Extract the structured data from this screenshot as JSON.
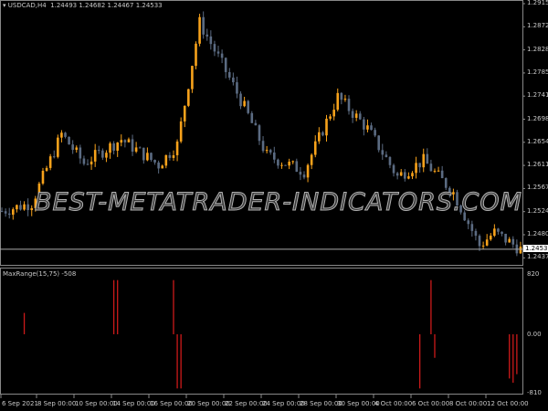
{
  "header": {
    "symbol": "USDCAD,H4",
    "quote": "1.24493 1.24682 1.24467 1.24533"
  },
  "price_axis": {
    "ticks": [
      "1.29155",
      "1.28720",
      "1.28285",
      "1.27850",
      "1.27415",
      "1.26980",
      "1.26545",
      "1.26110",
      "1.25675",
      "1.25240",
      "1.24805",
      "1.24370"
    ],
    "current": "1.24533"
  },
  "indicator": {
    "label": "MaxRange(15,75) -508",
    "ticks": [
      "820",
      "0.00",
      "-810"
    ]
  },
  "time_axis": [
    "6 Sep 2021",
    "8 Sep 00:00",
    "10 Sep 00:00",
    "14 Sep 00:00",
    "16 Sep 00:00",
    "20 Sep 00:00",
    "22 Sep 00:00",
    "24 Sep 00:00",
    "28 Sep 00:00",
    "30 Sep 00:00",
    "4 Oct 00:00",
    "6 Oct 00:00",
    "8 Oct 00:00",
    "12 Oct 00:00"
  ],
  "watermark": "BEST-METATRADER-INDICATORS.COM",
  "colors": {
    "bull": "#f7a21b",
    "bear": "#5b6b82",
    "indicator": "#cc1a1a",
    "axis": "#c8c8c8"
  },
  "chart_data": {
    "type": "candlestick",
    "price_range": [
      1.2425,
      1.2916
    ],
    "close_path": [
      [
        0,
        1.2525
      ],
      [
        8,
        1.254
      ],
      [
        16,
        1.267
      ],
      [
        22,
        1.2615
      ],
      [
        32,
        1.266
      ],
      [
        42,
        1.2612
      ],
      [
        47,
        1.265
      ],
      [
        53,
        1.288
      ],
      [
        61,
        1.2775
      ],
      [
        65,
        1.272
      ],
      [
        71,
        1.263
      ],
      [
        81,
        1.26
      ],
      [
        90,
        1.274
      ],
      [
        98,
        1.268
      ],
      [
        106,
        1.259
      ],
      [
        113,
        1.262
      ],
      [
        121,
        1.256
      ],
      [
        128,
        1.246
      ],
      [
        132,
        1.2485
      ],
      [
        139,
        1.2453
      ]
    ],
    "indicator_range": [
      -810,
      820
    ],
    "indicator_bars": [
      [
        6,
        300
      ],
      [
        30,
        760
      ],
      [
        31,
        760
      ],
      [
        46,
        760
      ],
      [
        47,
        -760
      ],
      [
        48,
        -760
      ],
      [
        112,
        -760
      ],
      [
        115,
        760
      ],
      [
        116,
        -330
      ],
      [
        136,
        -620
      ],
      [
        137,
        -680
      ],
      [
        138,
        -560
      ]
    ]
  }
}
